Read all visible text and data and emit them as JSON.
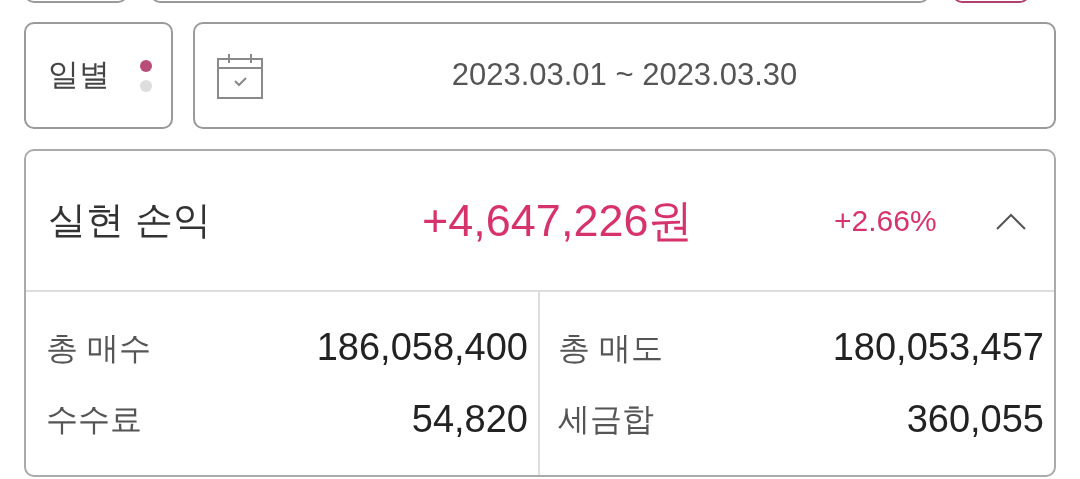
{
  "period": {
    "label": "일별",
    "dots": [
      {
        "selected": true
      },
      {
        "selected": false
      }
    ]
  },
  "date_range": {
    "value": "2023.03.01 ~ 2023.03.30"
  },
  "summary": {
    "title": "실현 손익",
    "amount": "+4,647,226원",
    "rate": "+2.66%",
    "expanded": true,
    "items": [
      {
        "label": "총 매수",
        "value": "186,058,400"
      },
      {
        "label": "총 매도",
        "value": "180,053,457"
      },
      {
        "label": "수수료",
        "value": "54,820"
      },
      {
        "label": "세금합",
        "value": "360,055"
      }
    ]
  }
}
